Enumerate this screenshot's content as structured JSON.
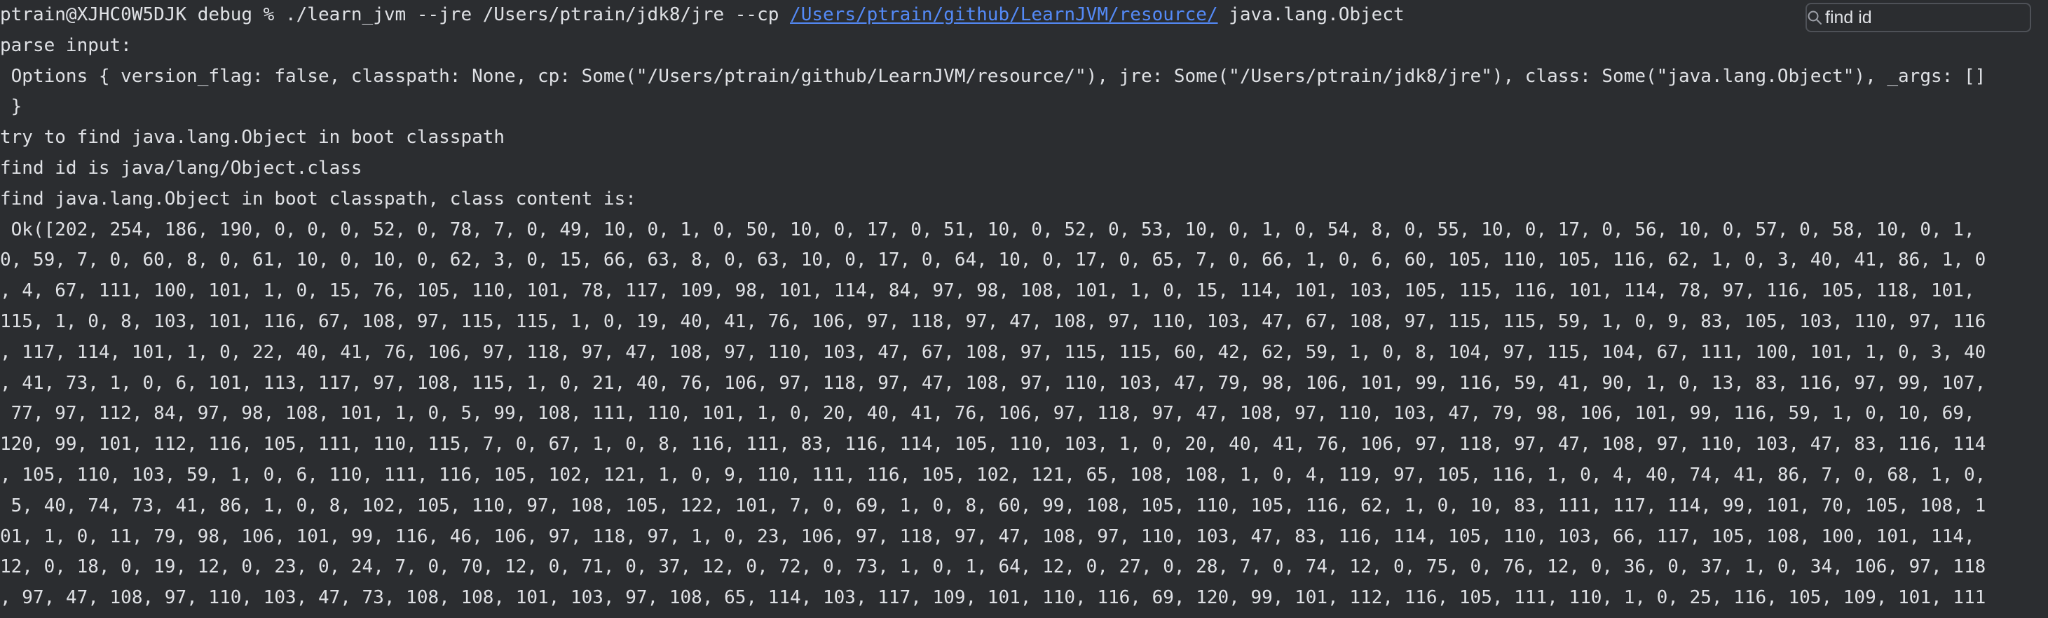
{
  "terminal": {
    "prompt": "ptrain@XJHC0W5DJK debug % ./learn_jvm --jre /Users/ptrain/jdk8/jre --cp ",
    "prompt_link": "/Users/ptrain/github/LearnJVM/resource/",
    "prompt_tail": " java.lang.Object",
    "lines": [
      "parse input:",
      " Options { version_flag: false, classpath: None, cp: Some(\"/Users/ptrain/github/LearnJVM/resource/\"), jre: Some(\"/Users/ptrain/jdk8/jre\"), class: Some(\"java.lang.Object\"), _args: [] ",
      " }",
      "try to find java.lang.Object in boot classpath",
      "find id is java/lang/Object.class",
      "find java.lang.Object in boot classpath, class content is:",
      " Ok([202, 254, 186, 190, 0, 0, 0, 52, 0, 78, 7, 0, 49, 10, 0, 1, 0, 50, 10, 0, 17, 0, 51, 10, 0, 52, 0, 53, 10, 0, 1, 0, 54, 8, 0, 55, 10, 0, 17, 0, 56, 10, 0, 57, 0, 58, 10, 0, 1, ",
      "0, 59, 7, 0, 60, 8, 0, 61, 10, 0, 10, 0, 62, 3, 0, 15, 66, 63, 8, 0, 63, 10, 0, 17, 0, 64, 10, 0, 17, 0, 65, 7, 0, 66, 1, 0, 6, 60, 105, 110, 105, 116, 62, 1, 0, 3, 40, 41, 86, 1, 0",
      ", 4, 67, 111, 100, 101, 1, 0, 15, 76, 105, 110, 101, 78, 117, 109, 98, 101, 114, 84, 97, 98, 108, 101, 1, 0, 15, 114, 101, 103, 105, 115, 116, 101, 114, 78, 97, 116, 105, 118, 101,",
      "115, 1, 0, 8, 103, 101, 116, 67, 108, 97, 115, 115, 1, 0, 19, 40, 41, 76, 106, 97, 118, 97, 47, 108, 97, 110, 103, 47, 67, 108, 97, 115, 115, 59, 1, 0, 9, 83, 105, 103, 110, 97, 116",
      ", 117, 114, 101, 1, 0, 22, 40, 41, 76, 106, 97, 118, 97, 47, 108, 97, 110, 103, 47, 67, 108, 97, 115, 115, 60, 42, 62, 59, 1, 0, 8, 104, 97, 115, 104, 67, 111, 100, 101, 1, 0, 3, 40",
      ", 41, 73, 1, 0, 6, 101, 113, 117, 97, 108, 115, 1, 0, 21, 40, 76, 106, 97, 118, 97, 47, 108, 97, 110, 103, 47, 79, 98, 106, 101, 99, 116, 59, 41, 90, 1, 0, 13, 83, 116, 97, 99, 107,",
      " 77, 97, 112, 84, 97, 98, 108, 101, 1, 0, 5, 99, 108, 111, 110, 101, 1, 0, 20, 40, 41, 76, 106, 97, 118, 97, 47, 108, 97, 110, 103, 47, 79, 98, 106, 101, 99, 116, 59, 1, 0, 10, 69,",
      "120, 99, 101, 112, 116, 105, 111, 110, 115, 7, 0, 67, 1, 0, 8, 116, 111, 83, 116, 114, 105, 110, 103, 1, 0, 20, 40, 41, 76, 106, 97, 118, 97, 47, 108, 97, 110, 103, 47, 83, 116, 114",
      ", 105, 110, 103, 59, 1, 0, 6, 110, 111, 116, 105, 102, 121, 1, 0, 9, 110, 111, 116, 105, 102, 121, 65, 108, 108, 1, 0, 4, 119, 97, 105, 116, 1, 0, 4, 40, 74, 41, 86, 7, 0, 68, 1, 0,",
      " 5, 40, 74, 73, 41, 86, 1, 0, 8, 102, 105, 110, 97, 108, 105, 122, 101, 7, 0, 69, 1, 0, 8, 60, 99, 108, 105, 110, 105, 116, 62, 1, 0, 10, 83, 111, 117, 114, 99, 101, 70, 105, 108, 1",
      "01, 1, 0, 11, 79, 98, 106, 101, 99, 116, 46, 106, 97, 118, 97, 1, 0, 23, 106, 97, 118, 97, 47, 108, 97, 110, 103, 47, 83, 116, 114, 105, 110, 103, 66, 117, 105, 108, 100, 101, 114,",
      "12, 0, 18, 0, 19, 12, 0, 23, 0, 24, 7, 0, 70, 12, 0, 71, 0, 37, 12, 0, 72, 0, 73, 1, 0, 1, 64, 12, 0, 27, 0, 28, 7, 0, 74, 12, 0, 75, 0, 76, 12, 0, 36, 0, 37, 1, 0, 34, 106, 97, 118",
      ", 97, 47, 108, 97, 110, 103, 47, 73, 108, 108, 101, 103, 97, 108, 65, 114, 103, 117, 109, 101, 110, 116, 69, 120, 99, 101, 112, 116, 105, 111, 110, 1, 0, 25, 116, 105, 109, 101, 111"
    ]
  },
  "find_bar": {
    "query": "find id",
    "icon": "search-icon",
    "close_icon": "close-icon"
  },
  "colors": {
    "background": "#2b2d30",
    "text": "#dfe1e5",
    "link": "#548af7"
  }
}
